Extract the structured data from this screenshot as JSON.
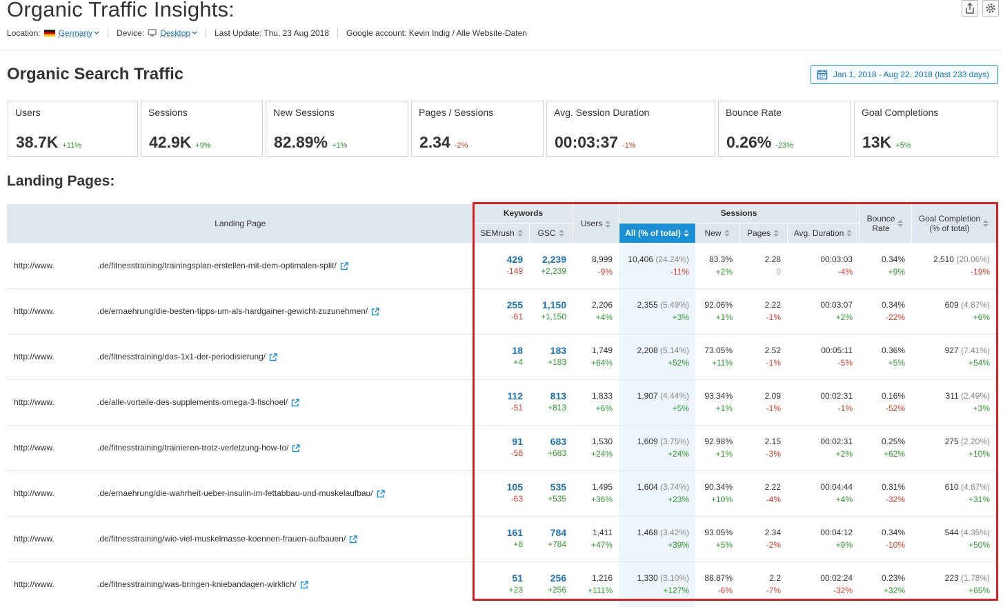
{
  "header": {
    "title": "Organic Traffic Insights:",
    "location_label": "Location:",
    "location_value": "Germany",
    "device_label": "Device:",
    "device_value": "Desktop",
    "last_update": "Last Update: Thu, 23 Aug 2018",
    "google_account": "Google account: Kevin Indig / Alle Website-Daten"
  },
  "section": {
    "title": "Organic Search Traffic",
    "date_range": "Jan 1, 2018 - Aug 22, 2018 (last 233 days)"
  },
  "metrics": [
    {
      "label": "Users",
      "value": "38.7K",
      "change": "+11%",
      "trend": "pos"
    },
    {
      "label": "Sessions",
      "value": "42.9K",
      "change": "+9%",
      "trend": "pos"
    },
    {
      "label": "New Sessions",
      "value": "82.89%",
      "change": "+1%",
      "trend": "pos"
    },
    {
      "label": "Pages / Sessions",
      "value": "2.34",
      "change": "-2%",
      "trend": "neg"
    },
    {
      "label": "Avg. Session Duration",
      "value": "00:03:37",
      "change": "-1%",
      "trend": "neg"
    },
    {
      "label": "Bounce Rate",
      "value": "0.26%",
      "change": "-23%",
      "trend": "pos"
    },
    {
      "label": "Goal Completions",
      "value": "13K",
      "change": "+5%",
      "trend": "pos"
    }
  ],
  "colors": {
    "positive": "#2e9a2e",
    "negative": "#d93b2b",
    "accent": "#1a8fd6",
    "highlight_box": "#e02020"
  },
  "landing": {
    "title": "Landing Pages:",
    "headers": {
      "landing_page": "Landing Page",
      "keywords": "Keywords",
      "semrush": "SEMrush",
      "gsc": "GSC",
      "users": "Users",
      "sessions": "Sessions",
      "all": "All (% of total)",
      "new": "New",
      "pages": "Pages",
      "avg_duration": "Avg. Duration",
      "bounce_1": "Bounce",
      "bounce_2": "Rate",
      "goal_1": "Goal Completion",
      "goal_2": "(% of total)"
    },
    "rows": [
      {
        "proto": "http://www.",
        "path": ".de/fitnesstraining/trainingsplan-erstellen-mit-dem-optimalen-split/",
        "semrush": "429",
        "semrush_chg": "-149",
        "gsc": "2,239",
        "gsc_chg": "+2,239",
        "users": "8,999",
        "users_chg": "-9%",
        "all": "10,406",
        "all_pct": "(24.24%)",
        "all_chg": "-11%",
        "new": "83.3%",
        "new_chg": "+2%",
        "pages": "2.28",
        "pages_chg": "0",
        "dur": "00:03:03",
        "dur_chg": "-4%",
        "bounce": "0.34%",
        "bounce_chg": "+9%",
        "goal": "2,510",
        "goal_pct": "(20.06%)",
        "goal_chg": "-19%"
      },
      {
        "proto": "http://www.",
        "path": ".de/ernaehrung/die-besten-tipps-um-als-hardgainer-gewicht-zuzunehmen/",
        "semrush": "255",
        "semrush_chg": "-61",
        "gsc": "1,150",
        "gsc_chg": "+1,150",
        "users": "2,206",
        "users_chg": "+4%",
        "all": "2,355",
        "all_pct": "(5.49%)",
        "all_chg": "+3%",
        "new": "92.06%",
        "new_chg": "+1%",
        "pages": "2.22",
        "pages_chg": "-1%",
        "dur": "00:03:07",
        "dur_chg": "+2%",
        "bounce": "0.34%",
        "bounce_chg": "-22%",
        "goal": "609",
        "goal_pct": "(4.87%)",
        "goal_chg": "+6%"
      },
      {
        "proto": "http://www.",
        "path": ".de/fitnesstraining/das-1x1-der-periodisierung/",
        "semrush": "18",
        "semrush_chg": "+4",
        "gsc": "183",
        "gsc_chg": "+183",
        "users": "1,749",
        "users_chg": "+64%",
        "all": "2,208",
        "all_pct": "(5.14%)",
        "all_chg": "+52%",
        "new": "73.05%",
        "new_chg": "+11%",
        "pages": "2.52",
        "pages_chg": "-1%",
        "dur": "00:05:11",
        "dur_chg": "-5%",
        "bounce": "0.36%",
        "bounce_chg": "+5%",
        "goal": "927",
        "goal_pct": "(7.41%)",
        "goal_chg": "+54%"
      },
      {
        "proto": "http://www.",
        "path": ".de/alle-vorteile-des-supplements-omega-3-fischoel/",
        "semrush": "112",
        "semrush_chg": "-51",
        "gsc": "813",
        "gsc_chg": "+813",
        "users": "1,833",
        "users_chg": "+6%",
        "all": "1,907",
        "all_pct": "(4.44%)",
        "all_chg": "+5%",
        "new": "93.34%",
        "new_chg": "+1%",
        "pages": "2.09",
        "pages_chg": "-1%",
        "dur": "00:02:31",
        "dur_chg": "-1%",
        "bounce": "0.16%",
        "bounce_chg": "-52%",
        "goal": "311",
        "goal_pct": "(2.49%)",
        "goal_chg": "+3%"
      },
      {
        "proto": "http://www.",
        "path": ".de/fitnesstraining/trainieren-trotz-verletzung-how-to/",
        "semrush": "91",
        "semrush_chg": "-58",
        "gsc": "683",
        "gsc_chg": "+683",
        "users": "1,530",
        "users_chg": "+24%",
        "all": "1,609",
        "all_pct": "(3.75%)",
        "all_chg": "+24%",
        "new": "92.98%",
        "new_chg": "+1%",
        "pages": "2.15",
        "pages_chg": "-3%",
        "dur": "00:02:31",
        "dur_chg": "+2%",
        "bounce": "0.25%",
        "bounce_chg": "+62%",
        "goal": "275",
        "goal_pct": "(2.20%)",
        "goal_chg": "+10%"
      },
      {
        "proto": "http://www.",
        "path": ".de/ernaehrung/die-wahrheit-ueber-insulin-im-fettabbau-und-muskelaufbau/",
        "semrush": "105",
        "semrush_chg": "-63",
        "gsc": "535",
        "gsc_chg": "+535",
        "users": "1,495",
        "users_chg": "+36%",
        "all": "1,604",
        "all_pct": "(3.74%)",
        "all_chg": "+23%",
        "new": "90.34%",
        "new_chg": "+10%",
        "pages": "2.22",
        "pages_chg": "-4%",
        "dur": "00:04:44",
        "dur_chg": "+4%",
        "bounce": "0.31%",
        "bounce_chg": "-32%",
        "goal": "610",
        "goal_pct": "(4.87%)",
        "goal_chg": "+31%"
      },
      {
        "proto": "http://www.",
        "path": ".de/fitnesstraining/wie-viel-muskelmasse-koennen-frauen-aufbauen/",
        "semrush": "161",
        "semrush_chg": "+8",
        "gsc": "784",
        "gsc_chg": "+784",
        "users": "1,411",
        "users_chg": "+47%",
        "all": "1,468",
        "all_pct": "(3.42%)",
        "all_chg": "+39%",
        "new": "93.05%",
        "new_chg": "+5%",
        "pages": "2.34",
        "pages_chg": "-2%",
        "dur": "00:04:12",
        "dur_chg": "+9%",
        "bounce": "0.34%",
        "bounce_chg": "-10%",
        "goal": "544",
        "goal_pct": "(4.35%)",
        "goal_chg": "+50%"
      },
      {
        "proto": "http://www.",
        "path": ".de/fitnesstraining/was-bringen-kniebandagen-wirklich/",
        "semrush": "51",
        "semrush_chg": "+23",
        "gsc": "256",
        "gsc_chg": "+256",
        "users": "1,216",
        "users_chg": "+111%",
        "all": "1,330",
        "all_pct": "(3.10%)",
        "all_chg": "+127%",
        "new": "88.87%",
        "new_chg": "-6%",
        "pages": "2.2",
        "pages_chg": "-7%",
        "dur": "00:02:24",
        "dur_chg": "-32%",
        "bounce": "0.23%",
        "bounce_chg": "+32%",
        "goal": "223",
        "goal_pct": "(1.78%)",
        "goal_chg": "+65%"
      }
    ]
  }
}
